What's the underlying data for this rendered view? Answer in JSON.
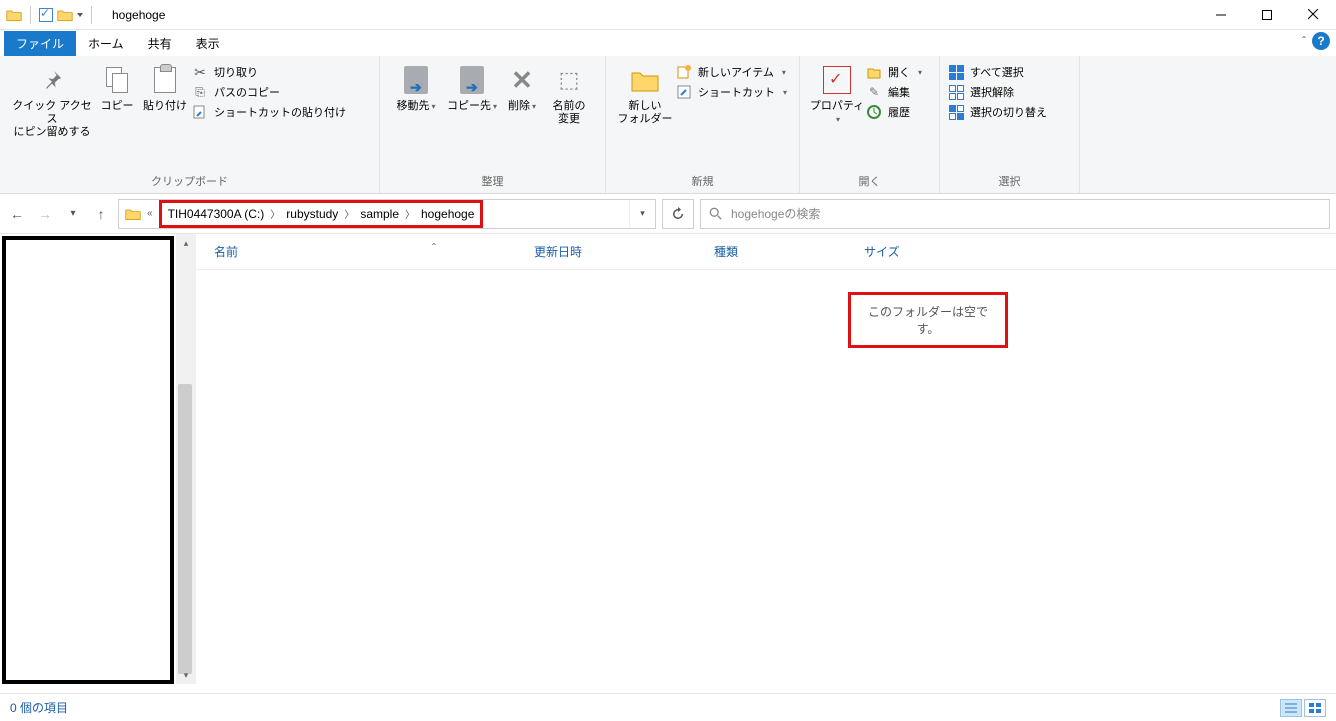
{
  "title": "hogehoge",
  "tabs": {
    "file": "ファイル",
    "home": "ホーム",
    "share": "共有",
    "view": "表示"
  },
  "ribbon": {
    "clipboard": {
      "pin": "クイック アクセス\nにピン留めする",
      "copy": "コピー",
      "paste": "貼り付け",
      "cut": "切り取り",
      "copy_path": "パスのコピー",
      "paste_shortcut": "ショートカットの貼り付け",
      "label": "クリップボード"
    },
    "organize": {
      "move_to": "移動先",
      "copy_to": "コピー先",
      "delete": "削除",
      "rename": "名前の\n変更",
      "label": "整理"
    },
    "new": {
      "new_folder": "新しい\nフォルダー",
      "new_item": "新しいアイテム",
      "shortcut": "ショートカット",
      "label": "新規"
    },
    "open": {
      "properties": "プロパティ",
      "open": "開く",
      "edit": "編集",
      "history": "履歴",
      "label": "開く"
    },
    "select": {
      "select_all": "すべて選択",
      "select_none": "選択解除",
      "select_invert": "選択の切り替え",
      "label": "選択"
    }
  },
  "breadcrumbs": [
    "TIH0447300A (C:)",
    "rubystudy",
    "sample",
    "hogehoge"
  ],
  "search_placeholder": "hogehogeの検索",
  "columns": {
    "name": "名前",
    "date": "更新日時",
    "type": "種類",
    "size": "サイズ"
  },
  "empty_message": "このフォルダーは空です。",
  "status": "0 個の項目"
}
